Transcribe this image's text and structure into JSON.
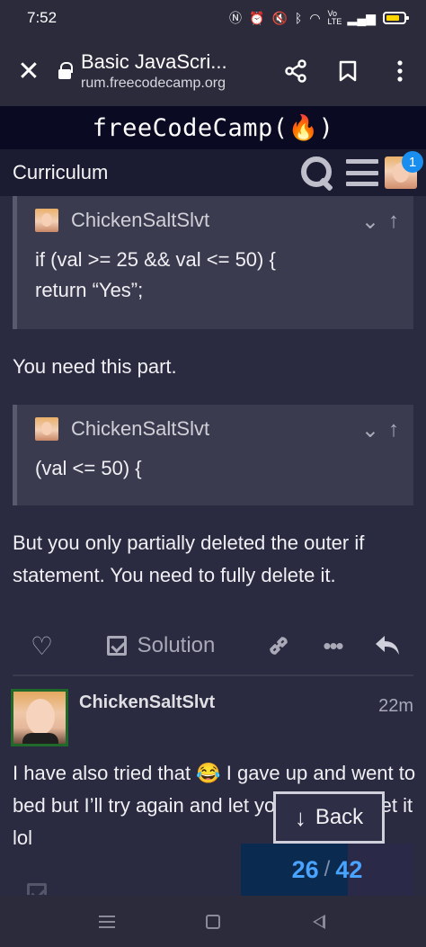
{
  "status_bar": {
    "time": "7:52",
    "icons": [
      "nfc-icon",
      "alarm-icon",
      "mute-icon",
      "bluetooth-icon",
      "wifi-icon",
      "volte-icon",
      "signal-icon",
      "battery-icon"
    ],
    "volte_label": "Vo LTE"
  },
  "browser": {
    "page_title": "Basic JavaScri...",
    "url": "rum.freecodecamp.org"
  },
  "site": {
    "logo": "freeCodeCamp(🔥)"
  },
  "forum": {
    "title": "Curriculum",
    "notification_count": "1"
  },
  "quotes": [
    {
      "author": "ChickenSaltSlvt",
      "lines": [
        "if (val >= 25 && val <= 50) {",
        "return “Yes”;"
      ]
    },
    {
      "author": "ChickenSaltSlvt",
      "lines": [
        "(val <= 50) {"
      ]
    }
  ],
  "reply": {
    "text1": "You need this part.",
    "text2": "But you only partially deleted the outer if statement. You need to fully delete it."
  },
  "post_actions": {
    "solution_label": "Solution"
  },
  "next_post": {
    "username": "ChickenSaltSlvt",
    "time": "22m",
    "text": "I have also tried that 😂 I gave up and went to bed but I’ll try again and let you know if I get it lol"
  },
  "back_button": {
    "label": "Back"
  },
  "progress": {
    "current": "26",
    "total": "42",
    "fraction": 0.62
  },
  "colors": {
    "accent": "#4aa3ff",
    "header": "#0a0a23",
    "badge": "#198eee",
    "background": "#2a2a40"
  }
}
